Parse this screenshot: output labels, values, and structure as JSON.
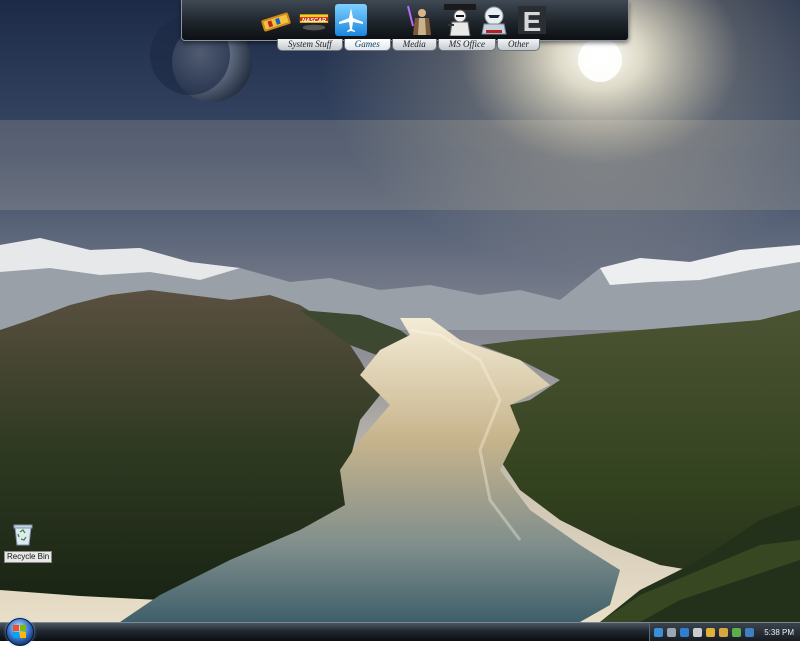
{
  "dock": {
    "tabs": [
      {
        "label": "System Stuff",
        "active": false
      },
      {
        "label": "Games",
        "active": true
      },
      {
        "label": "Media",
        "active": false
      },
      {
        "label": "MS Office",
        "active": false
      },
      {
        "label": "Other",
        "active": false
      }
    ],
    "icons": [
      {
        "name": "pinball-icon"
      },
      {
        "name": "nascar-icon",
        "text": "NASCAR"
      },
      {
        "name": "flight-simulator-icon"
      },
      {
        "name": "star-wars-jedi-icon"
      },
      {
        "name": "star-wars-battlefront-icon"
      },
      {
        "name": "star-wars-clone-icon"
      },
      {
        "name": "e-letter-icon",
        "text": "E"
      }
    ]
  },
  "desktop": {
    "icons": [
      {
        "label": "Recycle Bin",
        "icon": "recycle-bin-icon"
      }
    ]
  },
  "taskbar": {
    "clock": "5:38 PM",
    "tray_icons": [
      "network-icon",
      "volume-icon",
      "shield-icon",
      "printer-icon",
      "chat-icon",
      "folder-icon",
      "battery-icon",
      "update-icon"
    ]
  },
  "colors": {
    "taskbar": "#1a2129",
    "dock_tab_active": "#dfe8ee",
    "sky": "#5d6f8f"
  }
}
